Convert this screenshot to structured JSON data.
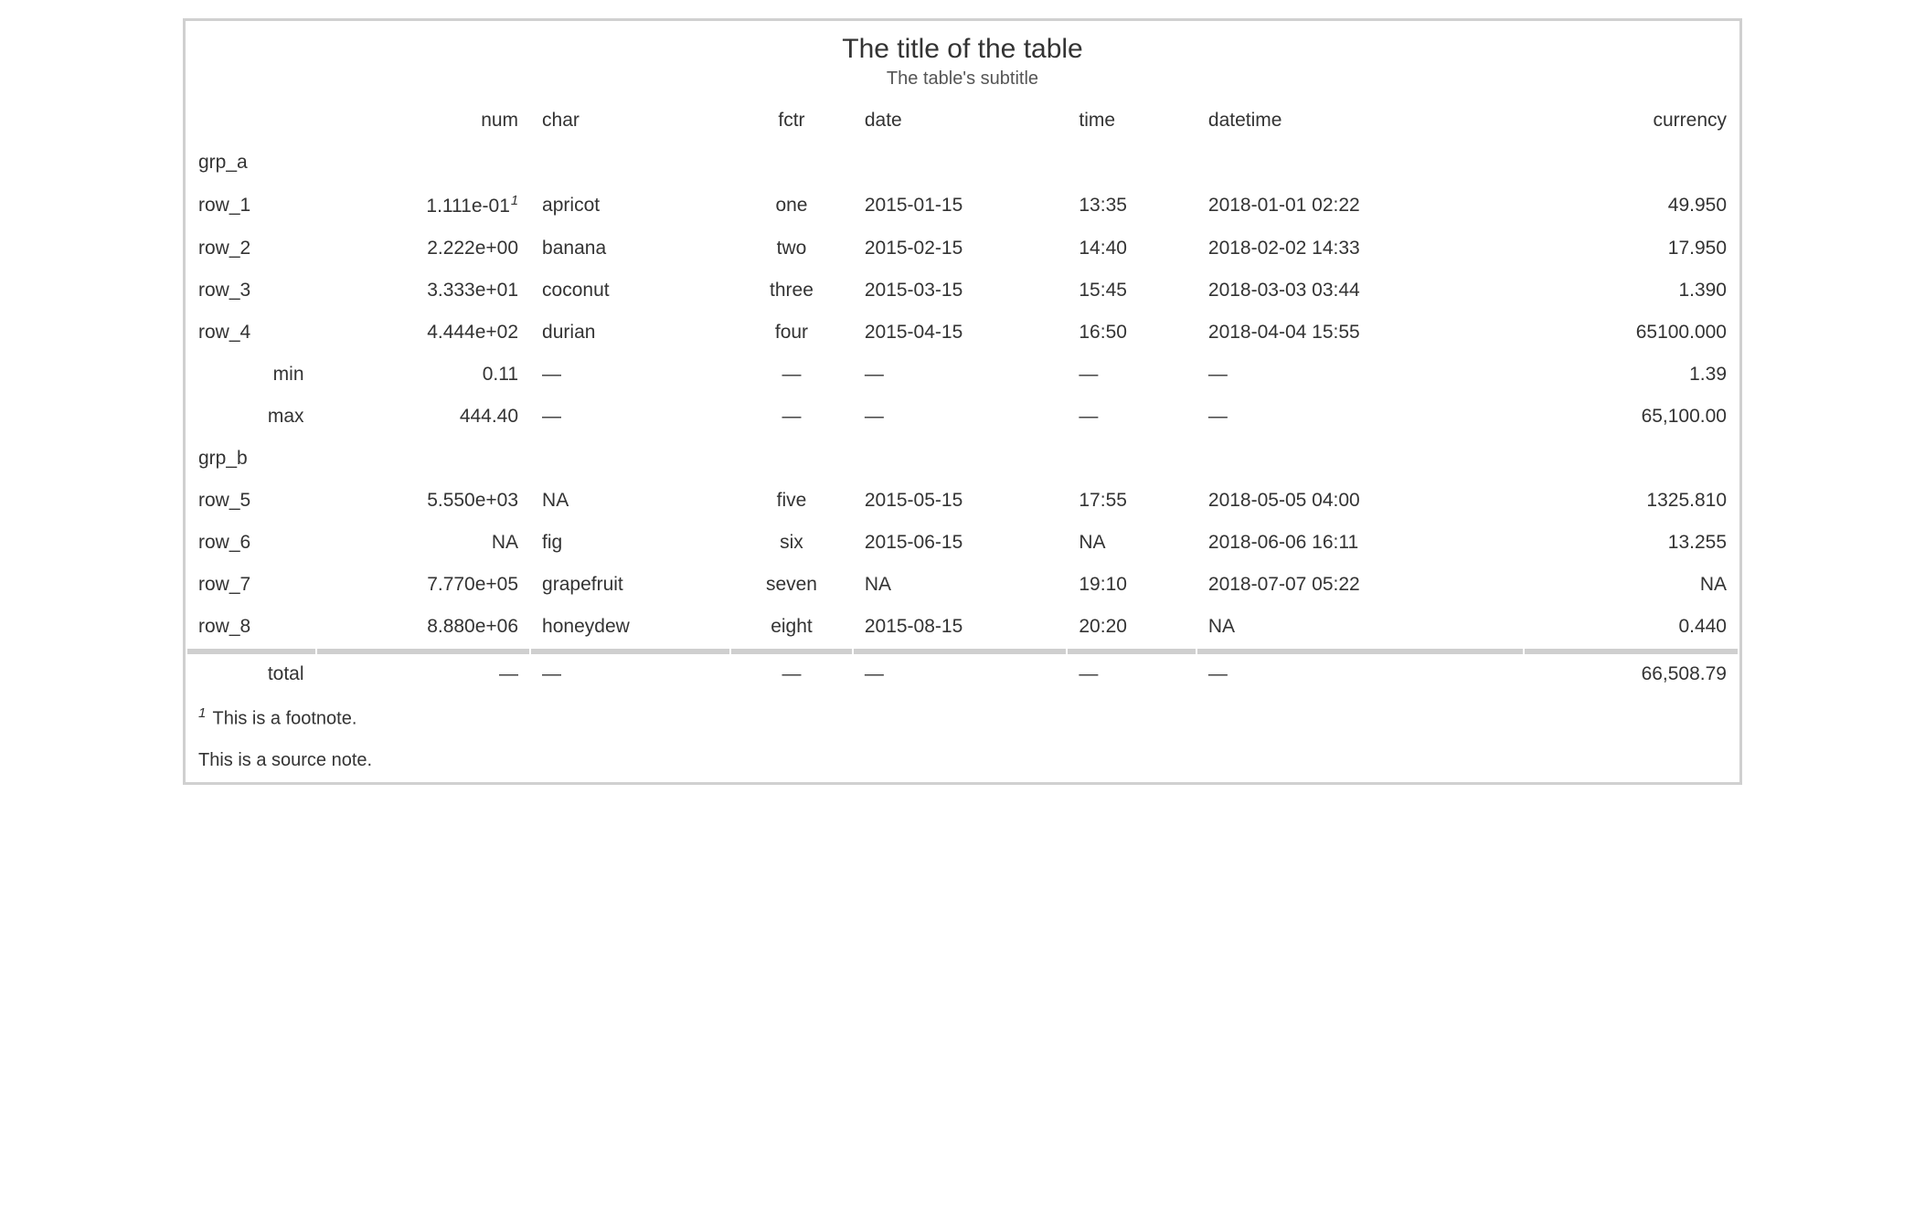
{
  "header": {
    "title": "The title of the table",
    "subtitle": "The table's subtitle"
  },
  "columns": {
    "stub": "",
    "num": "num",
    "char": "char",
    "fctr": "fctr",
    "date": "date",
    "time": "time",
    "datetime": "datetime",
    "currency": "currency"
  },
  "groups": [
    {
      "label": "grp_a",
      "rows": [
        {
          "stub": "row_1",
          "num": "1.111e-01",
          "num_footnote": "1",
          "char": "apricot",
          "fctr": "one",
          "date": "2015-01-15",
          "time": "13:35",
          "datetime": "2018-01-01 02:22",
          "currency": "49.950"
        },
        {
          "stub": "row_2",
          "num": "2.222e+00",
          "char": "banana",
          "fctr": "two",
          "date": "2015-02-15",
          "time": "14:40",
          "datetime": "2018-02-02 14:33",
          "currency": "17.950"
        },
        {
          "stub": "row_3",
          "num": "3.333e+01",
          "char": "coconut",
          "fctr": "three",
          "date": "2015-03-15",
          "time": "15:45",
          "datetime": "2018-03-03 03:44",
          "currency": "1.390"
        },
        {
          "stub": "row_4",
          "num": "4.444e+02",
          "char": "durian",
          "fctr": "four",
          "date": "2015-04-15",
          "time": "16:50",
          "datetime": "2018-04-04 15:55",
          "currency": "65100.000"
        }
      ],
      "summary": [
        {
          "stub": "min",
          "num": "0.11",
          "char": "—",
          "fctr": "—",
          "date": "—",
          "time": "—",
          "datetime": "—",
          "currency": "1.39"
        },
        {
          "stub": "max",
          "num": "444.40",
          "char": "—",
          "fctr": "—",
          "date": "—",
          "time": "—",
          "datetime": "—",
          "currency": "65,100.00"
        }
      ]
    },
    {
      "label": "grp_b",
      "rows": [
        {
          "stub": "row_5",
          "num": "5.550e+03",
          "char": "NA",
          "fctr": "five",
          "date": "2015-05-15",
          "time": "17:55",
          "datetime": "2018-05-05 04:00",
          "currency": "1325.810"
        },
        {
          "stub": "row_6",
          "num": "NA",
          "char": "fig",
          "fctr": "six",
          "date": "2015-06-15",
          "time": "NA",
          "datetime": "2018-06-06 16:11",
          "currency": "13.255"
        },
        {
          "stub": "row_7",
          "num": "7.770e+05",
          "char": "grapefruit",
          "fctr": "seven",
          "date": "NA",
          "time": "19:10",
          "datetime": "2018-07-07 05:22",
          "currency": "NA"
        },
        {
          "stub": "row_8",
          "num": "8.880e+06",
          "char": "honeydew",
          "fctr": "eight",
          "date": "2015-08-15",
          "time": "20:20",
          "datetime": "NA",
          "currency": "0.440"
        }
      ],
      "summary": []
    }
  ],
  "grand_summary": [
    {
      "stub": "total",
      "num": "—",
      "char": "—",
      "fctr": "—",
      "date": "—",
      "time": "—",
      "datetime": "—",
      "currency": "66,508.79"
    }
  ],
  "footnotes": [
    {
      "mark": "1",
      "text": "This is a footnote."
    }
  ],
  "source_notes": [
    "This is a source note."
  ],
  "chart_data": {
    "type": "table",
    "title": "The title of the table",
    "subtitle": "The table's subtitle",
    "columns": [
      "",
      "num",
      "char",
      "fctr",
      "date",
      "time",
      "datetime",
      "currency"
    ],
    "row_groups": [
      {
        "name": "grp_a",
        "rows": [
          [
            "row_1",
            "1.111e-01",
            "apricot",
            "one",
            "2015-01-15",
            "13:35",
            "2018-01-01 02:22",
            "49.950"
          ],
          [
            "row_2",
            "2.222e+00",
            "banana",
            "two",
            "2015-02-15",
            "14:40",
            "2018-02-02 14:33",
            "17.950"
          ],
          [
            "row_3",
            "3.333e+01",
            "coconut",
            "three",
            "2015-03-15",
            "15:45",
            "2018-03-03 03:44",
            "1.390"
          ],
          [
            "row_4",
            "4.444e+02",
            "durian",
            "four",
            "2015-04-15",
            "16:50",
            "2018-04-04 15:55",
            "65100.000"
          ]
        ],
        "summary": [
          [
            "min",
            "0.11",
            "—",
            "—",
            "—",
            "—",
            "—",
            "1.39"
          ],
          [
            "max",
            "444.40",
            "—",
            "—",
            "—",
            "—",
            "—",
            "65,100.00"
          ]
        ]
      },
      {
        "name": "grp_b",
        "rows": [
          [
            "row_5",
            "5.550e+03",
            "NA",
            "five",
            "2015-05-15",
            "17:55",
            "2018-05-05 04:00",
            "1325.810"
          ],
          [
            "row_6",
            "NA",
            "fig",
            "six",
            "2015-06-15",
            "NA",
            "2018-06-06 16:11",
            "13.255"
          ],
          [
            "row_7",
            "7.770e+05",
            "grapefruit",
            "seven",
            "NA",
            "19:10",
            "2018-07-07 05:22",
            "NA"
          ],
          [
            "row_8",
            "8.880e+06",
            "honeydew",
            "eight",
            "2015-08-15",
            "20:20",
            "NA",
            "0.440"
          ]
        ],
        "summary": []
      }
    ],
    "grand_summary": [
      [
        "total",
        "—",
        "—",
        "—",
        "—",
        "—",
        "—",
        "66,508.79"
      ]
    ],
    "footnotes": [
      "1 This is a footnote."
    ],
    "source_notes": [
      "This is a source note."
    ]
  }
}
